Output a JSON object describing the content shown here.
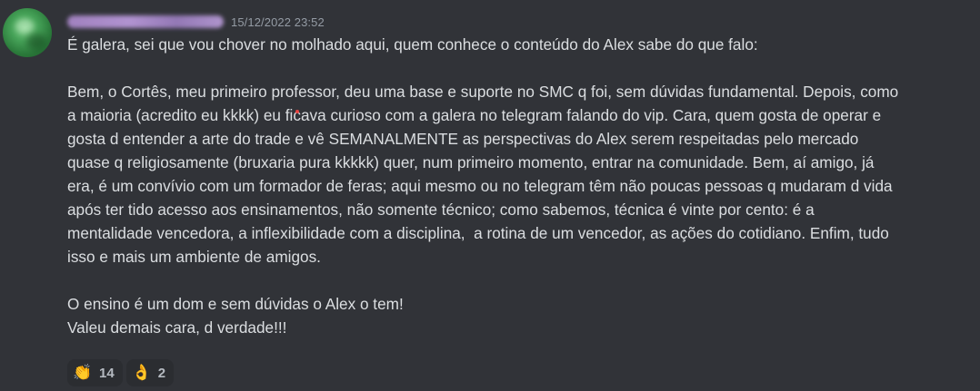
{
  "message": {
    "timestamp": "15/12/2022 23:52",
    "paragraphs": [
      "É galera, sei que vou chover no molhado aqui, quem conhece o conteúdo do Alex sabe do que falo:",
      "Bem, o Cortês, meu primeiro professor, deu uma base e suporte no SMC q foi, sem dúvidas fundamental. Depois, como\na maioria (acredito eu kkkk) eu ficava curioso com a galera no telegram falando do vip. Cara, quem gosta de operar e\ngosta d entender a arte do trade e vê SEMANALMENTE as perspectivas do Alex serem respeitadas pelo mercado\nquase q religiosamente (bruxaria pura kkkkk) quer, num primeiro momento, entrar na comunidade. Bem, aí amigo, já\nera, é um convívio com um formador de feras; aqui mesmo ou no telegram têm não poucas pessoas q mudaram d vida\napós ter tido acesso aos ensinamentos, não somente técnico; como sabemos, técnica é vinte por cento: é a\nmentalidade vencedora, a inflexibilidade com a disciplina,  a rotina de um vencedor, as ações do cotidiano. Enfim, tudo\nisso e mais um ambiente de amigos.",
      "O ensino é um dom e sem dúvidas o Alex o tem!\nValeu demais cara, d verdade!!!"
    ]
  },
  "reactions": [
    {
      "icon": "clapping-hands-icon",
      "emoji": "👏",
      "count": "14"
    },
    {
      "icon": "ok-hand-icon",
      "emoji": "👌",
      "count": "2"
    }
  ],
  "colors": {
    "background": "#313338",
    "text": "#dbdee1",
    "timestamp": "#949ba4",
    "reaction_bg": "#2b2d31"
  }
}
